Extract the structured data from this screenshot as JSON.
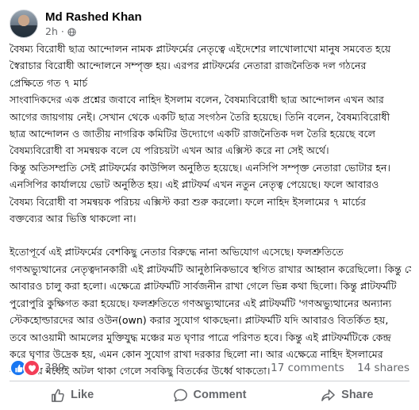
{
  "post": {
    "author": "Md Rashed Khan",
    "time": "2h",
    "separator": "·",
    "paragraphs": [
      {
        "lines": [
          "বৈষম্য বিরোধী ছাত্র আন্দোলন নামক প্লাটফর্মের নেতৃত্বে এইদেশের লাখোলাখো মানুষ সমবেত হয়ে",
          "স্বৈরাচার বিরোধী আন্দোলনে সম্পৃক্ত হয়। এরপর প্লাটফর্মের নেতারা রাজনৈতিক দল গঠনের",
          "প্রেক্ষিতে গত ৭ মার্চ",
          "সাংবাদিকদের এক প্রশ্নের জবাবে নাহিদ ইসলাম বলেন, বৈষম্যবিরোধী ছাত্র আন্দোলন এখন আর",
          "আগের জায়গায় নেই। সেখান থেকে একটি ছাত্র সংগঠন তৈরি হয়েছে। তিনি বলেন, বৈষম্যবিরোধী",
          "ছাত্র আন্দোলন ও জাতীয় নাগরিক কমিটির উদ্যোগে একটি রাজনৈতিক দল তৈরি হয়েছে বলে",
          "বৈষম্যবিরোধী বা সমন্বয়ক বলে যে পরিচয়টা এখন আর এক্সিস্ট করে না সেই অর্থে।",
          "কিন্তু অতিসম্প্রতি সেই প্লাটফর্মের কাউন্সিল অনুষ্ঠিত হয়েছে। এনসিপি সম্পৃক্ত নেতারা ভোটার হন।",
          "এনসিপির কার্যালয়ে ভোট অনুষ্ঠিত হয়। এই প্লাটফর্ম এখন নতুন নেতৃত্ব পেয়েছে। ফলে আবারও",
          "বৈষম্য বিরোধী বা সমন্বয়ক পরিচয় এক্সিস্ট করা শুরু করলো। ফলে নাহিদ ইসলামের ৭ মার্চের",
          "বক্তব্যের আর ভিত্তি থাকলো না।"
        ]
      },
      {
        "lines": [
          "ইতোপূর্বে এই প্লাটফর্মের বেশকিছু নেতার বিরুদ্ধে নানা অভিযোগ এসেছে। ফলশ্রুতিতে",
          "গণঅভ্যুত্থানের নেতৃত্বদানকারী এই প্লাটফর্মটি আনুষ্ঠানিকভাবে স্থগিত রাখার আহ্বান করেছিলো। কিন্তু সেটি",
          "আবারও চালু করা হলো। এক্ষেত্রে প্লাটফর্মটি সার্বজনীন রাখা গেলে ভিন্ন কথা ছিলো। কিন্তু প্লাটফর্মটি",
          "পুরোপুরি কুক্ষিগত করা হয়েছে। ফলশ্রুতিতে গণঅভ্যুত্থানের এই প্লাটফর্মটি 'গণঅভ্যুত্থানের অন্যান্য",
          "স্টেকহোল্ডারদের আর ওউন(own) করার সুযোগ থাকছেনা। প্লাটফর্মটি যদি আবারও বিতর্কিত হয়,",
          "তবে আওয়ামী আমলের মুক্তিযুদ্ধ মঞ্চের মত ঘৃণার পাত্রে পরিণত হবে। কিন্তু এই প্লাটফর্মটিকে কেন্দ্র",
          "করে ঘৃণার উদ্রেক হয়, এমন কোন সুযোগ রাখা দরকার ছিলো না।  আর এক্ষেত্রে নাহিদ ইসলামের",
          "বক্তব্যের মধ্যেই অটল থাকা গেলে সবকিছু বিতর্কের উর্ধ্বে থাকতো।"
        ]
      }
    ]
  },
  "stats": {
    "reactions_count": "389",
    "comments": "17 comments",
    "shares": "14 shares"
  },
  "actions": {
    "like": "Like",
    "comment": "Comment",
    "share": "Share"
  },
  "colors": {
    "like_blue": "#1877f2",
    "love_red": "#f33e58",
    "secondary_text": "#65676b"
  }
}
